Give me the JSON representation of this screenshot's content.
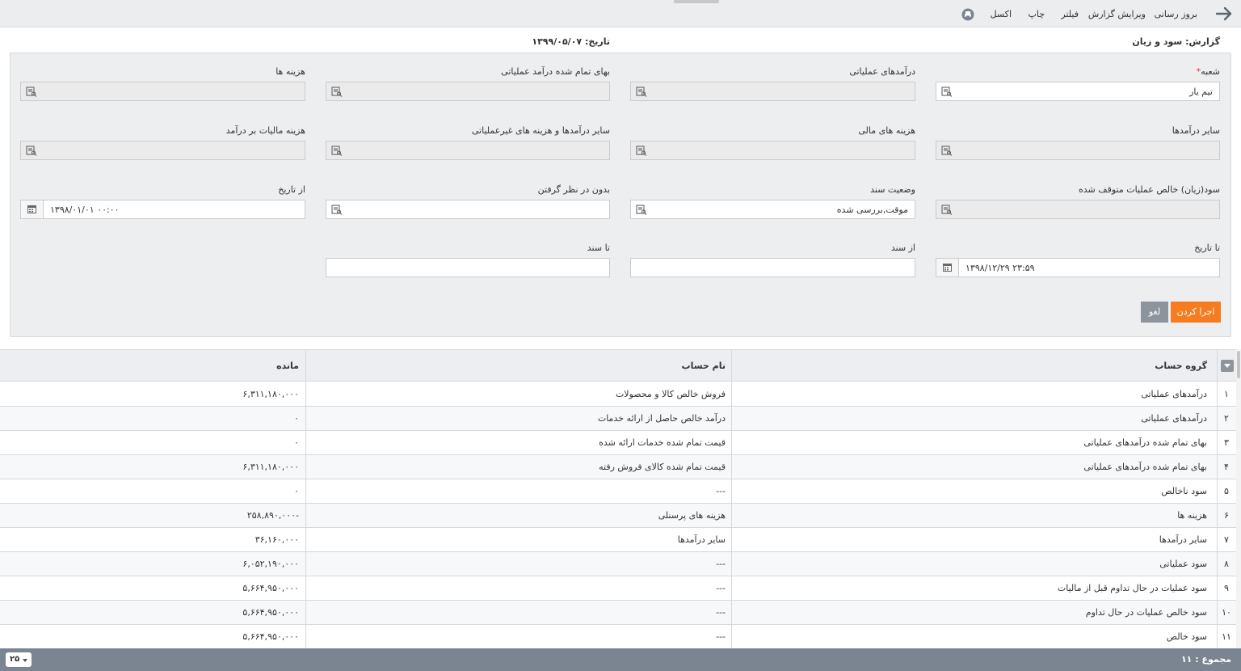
{
  "toolbar": {
    "refresh": "بروز رسانی",
    "edit_report": "ویرایش گزارش",
    "filter": "فیلتر",
    "print": "چاپ",
    "excel": "اکسل"
  },
  "header": {
    "title": "گزارش: سود و زیان",
    "date": "تاریخ: ۱۳۹۹/۰۵/۰۷"
  },
  "form": {
    "branch_label": "شعبه",
    "branch_required_mark": "*",
    "branch_value": "تیم یار",
    "operating_revenue_label": "درآمدهای عملیاتی",
    "cost_of_revenue_label": "بهای تمام شده درآمد عملیاتی",
    "expenses_label": "هزینه ها",
    "other_income_label": "سایر درآمدها",
    "financial_costs_label": "هزینه های مالی",
    "other_non_operating_label": "سایر درآمدها و هزینه های غیرعملیاتی",
    "income_tax_label": "هزینه مالیات بر درآمد",
    "discontinued_ops_label": "سود(زیان) خالص عملیات متوقف شده",
    "doc_status_label": "وضعیت سند",
    "doc_status_value": "موقت,بررسی شده",
    "ignore_label": "بدون در نظر گرفتن",
    "from_date_label": "از تاریخ",
    "from_date_value": "۱۳۹۸/۰۱/۰۱ ۰۰:۰۰",
    "to_date_label": "تا تاریخ",
    "to_date_value": "۱۳۹۸/۱۲/۲۹ ۲۳:۵۹",
    "from_doc_label": "از سند",
    "to_doc_label": "تا سند",
    "run_button": "اجرا کردن",
    "cancel_button": "لغو"
  },
  "table": {
    "columns": {
      "group": "گروه حساب",
      "account": "نام حساب",
      "balance": "مانده"
    },
    "rows": [
      {
        "n": "۱",
        "group": "درآمدهای عملیاتی",
        "account": "فروش خالص کالا و محصولات",
        "balance": "۶,۳۱۱,۱۸۰,۰۰۰"
      },
      {
        "n": "۲",
        "group": "درآمدهای عملیاتی",
        "account": "درآمد خالص حاصل از ارائه خدمات",
        "balance": "۰"
      },
      {
        "n": "۳",
        "group": "بهای تمام شده درآمدهای عملیاتی",
        "account": "قیمت تمام شده خدمات ارائه شده",
        "balance": "۰"
      },
      {
        "n": "۴",
        "group": "بهای تمام شده درآمدهای عملیاتی",
        "account": "قیمت تمام شده کالای فروش رفته",
        "balance": "۶,۳۱۱,۱۸۰,۰۰۰"
      },
      {
        "n": "۵",
        "group": "سود ناخالص",
        "account": "---",
        "balance": "۰"
      },
      {
        "n": "۶",
        "group": "هزینه ها",
        "account": "هزینه های پرسنلی",
        "balance": "-۲۵۸,۸۹۰,۰۰۰"
      },
      {
        "n": "۷",
        "group": "سایر درآمدها",
        "account": "سایر درآمدها",
        "balance": "۳۶,۱۶۰,۰۰۰"
      },
      {
        "n": "۸",
        "group": "سود عملیاتی",
        "account": "---",
        "balance": "۶,۰۵۲,۱۹۰,۰۰۰"
      },
      {
        "n": "۹",
        "group": "سود عملیات در حال تداوم قبل از مالیات",
        "account": "---",
        "balance": "۵,۶۶۴,۹۵۰,۰۰۰"
      },
      {
        "n": "۱۰",
        "group": "سود خالص عملیات در حال تداوم",
        "account": "---",
        "balance": "۵,۶۶۴,۹۵۰,۰۰۰"
      },
      {
        "n": "۱۱",
        "group": "سود خالص",
        "account": "---",
        "balance": "۵,۶۶۴,۹۵۰,۰۰۰"
      }
    ]
  },
  "footer": {
    "total": "مجموع : ۱۱",
    "page_size": "۲۵"
  },
  "icons": {
    "back": "arrow-right-icon",
    "print": "print-icon",
    "lookup": "lookup-icon",
    "calendar": "calendar-icon"
  },
  "colors": {
    "run_button": "#f57c20",
    "cancel_button": "#8d949c",
    "footer": "#7b8491",
    "required": "#e53935"
  }
}
